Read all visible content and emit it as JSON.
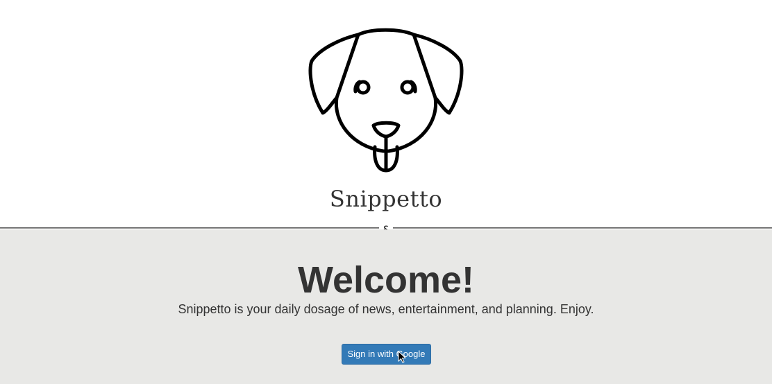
{
  "header": {
    "logo_icon": "dog-face-icon",
    "app_title": "Snippetto",
    "divider_mark": "§"
  },
  "main": {
    "welcome_title": "Welcome!",
    "tagline": "Snippetto is your daily dosage of news, entertainment, and planning. Enjoy.",
    "signin_label": "Sign in with Google"
  },
  "colors": {
    "button_bg": "#337ab7",
    "main_bg": "#e8e8e6",
    "text": "#333333"
  }
}
